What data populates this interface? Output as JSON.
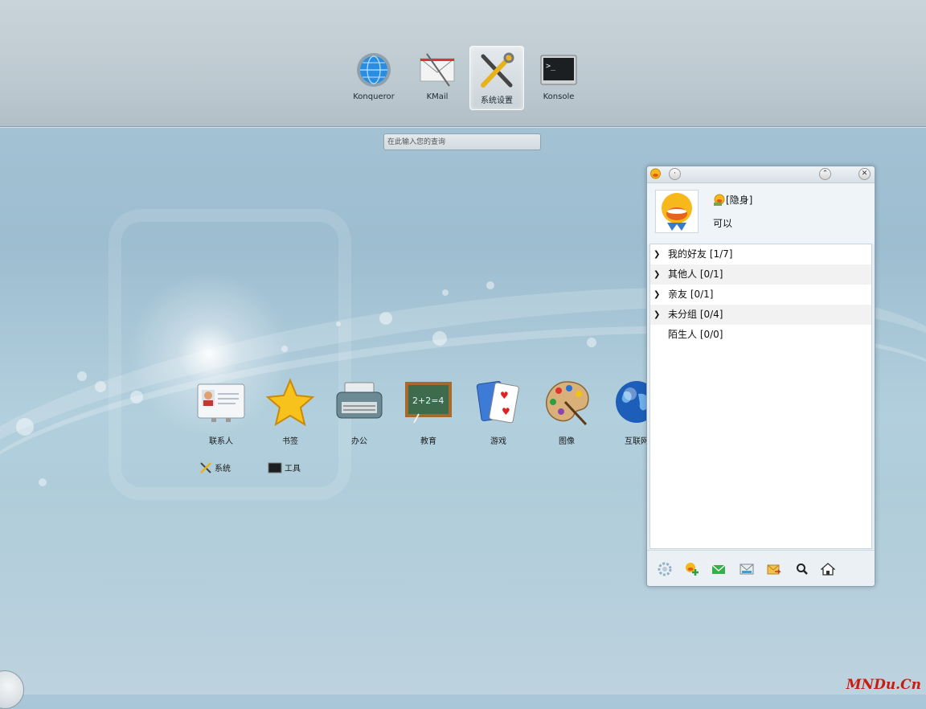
{
  "favorites": [
    {
      "label": "Konqueror",
      "icon": "globe-icon"
    },
    {
      "label": "KMail",
      "icon": "mail-icon"
    },
    {
      "label": "系统设置",
      "icon": "settings-tools-icon",
      "selected": true
    },
    {
      "label": "Konsole",
      "icon": "terminal-icon"
    }
  ],
  "search": {
    "placeholder": "在此输入您的查询"
  },
  "categories": [
    {
      "label": "联系人",
      "icon": "contact-card-icon"
    },
    {
      "label": "书签",
      "icon": "star-icon"
    },
    {
      "label": "办公",
      "icon": "typewriter-icon"
    },
    {
      "label": "教育",
      "icon": "chalkboard-icon"
    },
    {
      "label": "游戏",
      "icon": "playing-cards-icon"
    },
    {
      "label": "图像",
      "icon": "paint-palette-icon"
    },
    {
      "label": "互联网",
      "icon": "globe-icon"
    }
  ],
  "subcategories": [
    {
      "label": "系统",
      "icon": "tools-icon"
    },
    {
      "label": "工具",
      "icon": "terminal-icon"
    }
  ],
  "qq": {
    "status": "[隐身]",
    "signature": "可以",
    "groups": [
      {
        "label": "我的好友 [1/7]",
        "expandable": true
      },
      {
        "label": "其他人 [0/1]",
        "expandable": true
      },
      {
        "label": "亲友 [0/1]",
        "expandable": true
      },
      {
        "label": "未分组 [0/4]",
        "expandable": true
      },
      {
        "label": "陌生人 [0/0]",
        "expandable": false
      }
    ],
    "tools": [
      "settings-icon",
      "add-contact-icon",
      "message-icon",
      "mailbox-icon",
      "transfer-icon",
      "search-icon",
      "home-icon"
    ]
  },
  "watermark": "MNDu.Cn",
  "colors": {
    "accent": "#1e7fd8",
    "qq_yellow": "#f6b81a",
    "watermark": "#c81d12"
  }
}
